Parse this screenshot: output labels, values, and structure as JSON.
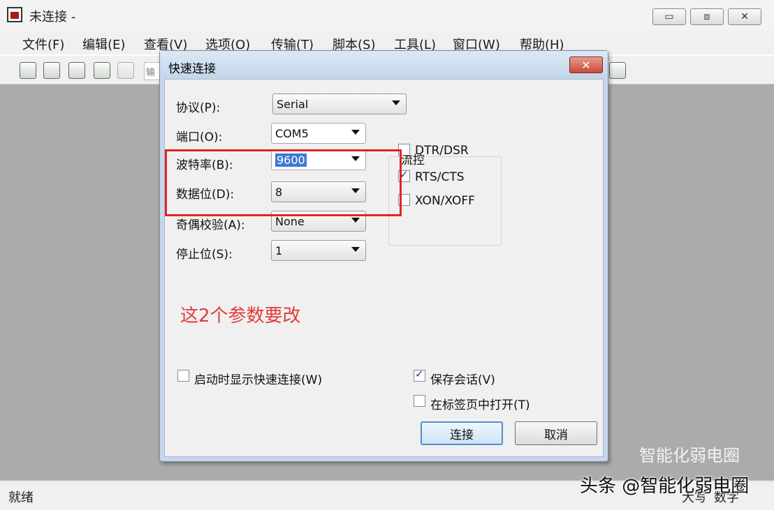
{
  "window": {
    "title": "未连接 -",
    "controls": [
      "▭",
      "⧈",
      "✕"
    ]
  },
  "menu": [
    "文件(F)",
    "编辑(E)",
    "查看(V)",
    "选项(O)",
    "传输(T)",
    "脚本(S)",
    "工具(L)",
    "窗口(W)",
    "帮助(H)"
  ],
  "toolbar": {
    "field_text": "输"
  },
  "status": {
    "left": "就绪",
    "right": [
      "大写",
      "数字"
    ]
  },
  "dialog": {
    "title": "快速连接",
    "close_label": "✕",
    "protocol": {
      "label": "协议(P):",
      "value": "Serial"
    },
    "port": {
      "label": "端口(O):",
      "value": "COM5"
    },
    "baud": {
      "label": "波特率(B):",
      "value": "9600"
    },
    "databits": {
      "label": "数据位(D):",
      "value": "8"
    },
    "parity": {
      "label": "奇偶校验(A):",
      "value": "None"
    },
    "stopbits": {
      "label": "停止位(S):",
      "value": "1"
    },
    "flow_control": {
      "title": "流控",
      "options": [
        {
          "label": "DTR/DSR",
          "checked": false
        },
        {
          "label": "RTS/CTS",
          "checked": true
        },
        {
          "label": "XON/XOFF",
          "checked": false
        }
      ]
    },
    "annotation": "这2个参数要改",
    "show_on_startup": {
      "label": "启动时显示快速连接(W)",
      "checked": false
    },
    "save_session": {
      "label": "保存会话(V)",
      "checked": true
    },
    "open_in_tab": {
      "label": "在标签页中打开(T)",
      "checked": false
    },
    "connect_label": "连接",
    "cancel_label": "取消"
  },
  "watermark": {
    "line1": "智能化弱电圈",
    "line2": "头条 @智能化弱电圈"
  },
  "colors": {
    "highlight": "#e02424",
    "annotation": "#e13b3b",
    "selection": "#3d79d6"
  }
}
